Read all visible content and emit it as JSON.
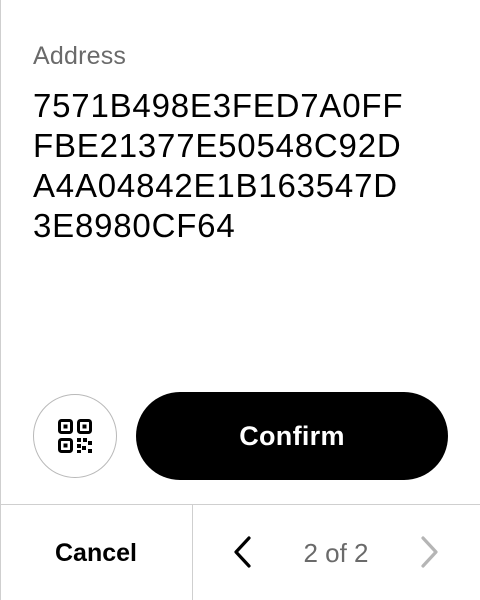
{
  "address": {
    "label": "Address",
    "lines": [
      "7571B498E3FED7A0FF",
      "FBE21377E50548C92D",
      "A4A04842E1B163547D",
      "3E8980CF64"
    ]
  },
  "actions": {
    "qr_icon": "qr-code-icon",
    "confirm_label": "Confirm"
  },
  "footer": {
    "cancel_label": "Cancel",
    "page_indicator": "2 of 2",
    "prev_icon": "chevron-left-icon",
    "next_icon": "chevron-right-icon"
  }
}
